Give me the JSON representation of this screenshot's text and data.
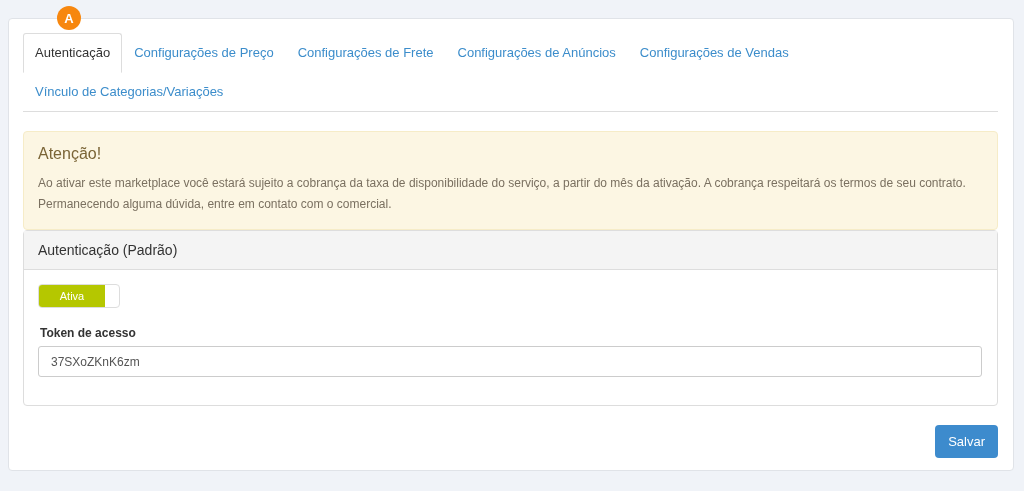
{
  "badge": "A",
  "tabs": [
    {
      "label": "Autenticação",
      "selected": true
    },
    {
      "label": "Configurações de Preço",
      "selected": false
    },
    {
      "label": "Configurações de Frete",
      "selected": false
    },
    {
      "label": "Configurações de Anúncios",
      "selected": false
    },
    {
      "label": "Configurações de Vendas",
      "selected": false
    },
    {
      "label": "Vínculo de Categorias/Variações",
      "selected": false
    }
  ],
  "alert": {
    "title": "Atenção!",
    "text": "Ao ativar este marketplace você estará sujeito a cobrança da taxa de disponibilidade do serviço, a partir do mês da ativação. A cobrança respeitará os termos de seu contrato. Permanecendo alguma dúvida, entre em contato com o comercial."
  },
  "panel": {
    "title": "Autenticação (Padrão)",
    "switch": {
      "label": "Ativa",
      "on": true
    },
    "field": {
      "label": "Token de acesso",
      "value": "37SXoZKnK6zm"
    }
  },
  "buttons": [
    "Salvar"
  ]
}
